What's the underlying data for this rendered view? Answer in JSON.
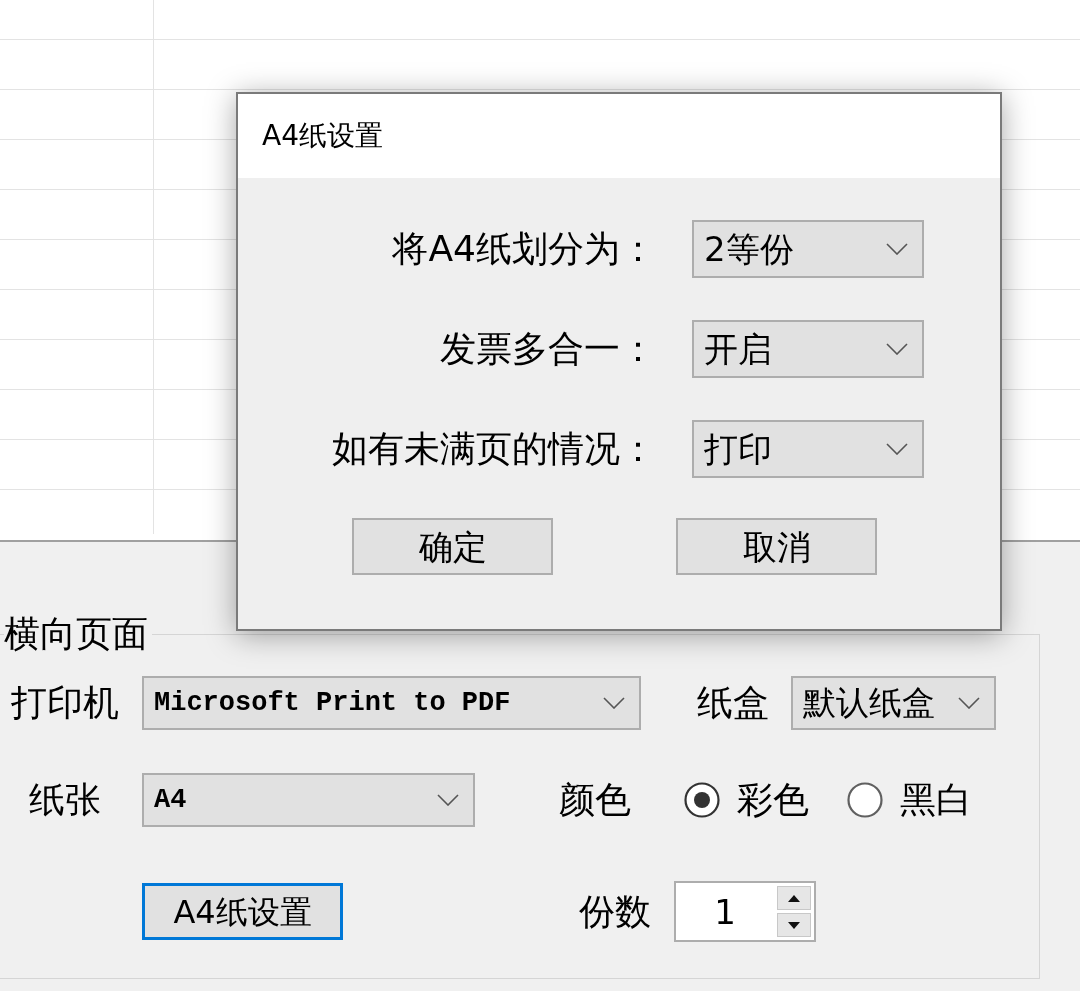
{
  "dialog": {
    "title": "A4纸设置",
    "fields": [
      {
        "label": "将A4纸划分为：",
        "value": "2等份"
      },
      {
        "label": "发票多合一：",
        "value": "开启"
      },
      {
        "label": "如有未满页的情况：",
        "value": "打印"
      }
    ],
    "buttons": [
      "确定",
      "取消"
    ]
  },
  "print_settings": {
    "group_title": "横向页面",
    "printer": {
      "label": "打印机",
      "value": "Microsoft Print to PDF"
    },
    "tray": {
      "label": "纸盒",
      "value": "默认纸盒"
    },
    "paper": {
      "label": "纸张",
      "value": "A4"
    },
    "color": {
      "label": "颜色",
      "options": [
        {
          "label": "彩色",
          "selected": true
        },
        {
          "label": "黑白",
          "selected": false
        }
      ]
    },
    "a4_button": {
      "label": "A4纸设置",
      "focused": true
    },
    "copies": {
      "label": "份数",
      "value": "1"
    }
  }
}
